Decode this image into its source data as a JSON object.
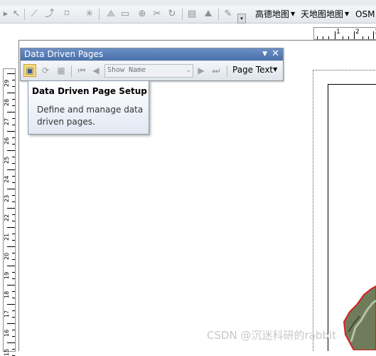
{
  "toolbar": {
    "menus": [
      {
        "label": "高德地图"
      },
      {
        "label": "天地图地图"
      },
      {
        "label": "OSM"
      }
    ]
  },
  "ruler_h": {
    "labels": [
      "1",
      "2",
      "3"
    ]
  },
  "ruler_v": {
    "labels": [
      "29",
      "28",
      "27",
      "26",
      "25",
      "24",
      "23",
      "22",
      "21",
      "20",
      "19",
      "18",
      "17",
      "16",
      "15"
    ]
  },
  "ddp": {
    "title": "Data Driven Pages",
    "combo_value": "Show Name",
    "page_text_label": "Page Text"
  },
  "tooltip": {
    "title": "Data Driven Page Setup",
    "body": "Define and manage data driven pages."
  },
  "watermark": "CSDN @沉迷科研的rabbit"
}
